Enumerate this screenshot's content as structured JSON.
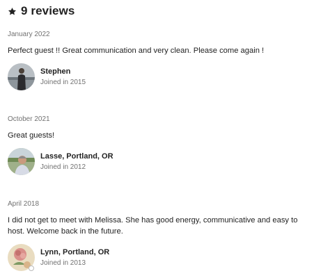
{
  "header": {
    "title": "9 reviews",
    "icon": "star-icon"
  },
  "reviews": [
    {
      "date": "January 2022",
      "text": "Perfect guest !! Great communication and very clean. Please come again !",
      "reviewer": {
        "name": "Stephen",
        "joined": "Joined in 2015"
      }
    },
    {
      "date": "October 2021",
      "text": "Great guests!",
      "reviewer": {
        "name": "Lasse, Portland, OR",
        "joined": "Joined in 2012"
      }
    },
    {
      "date": "April 2018",
      "text": "I did not get to meet with Melissa. She has good energy, communicative and easy to host. Welcome back in the future.",
      "reviewer": {
        "name": "Lynn, Portland, OR",
        "joined": "Joined in 2013"
      }
    }
  ]
}
